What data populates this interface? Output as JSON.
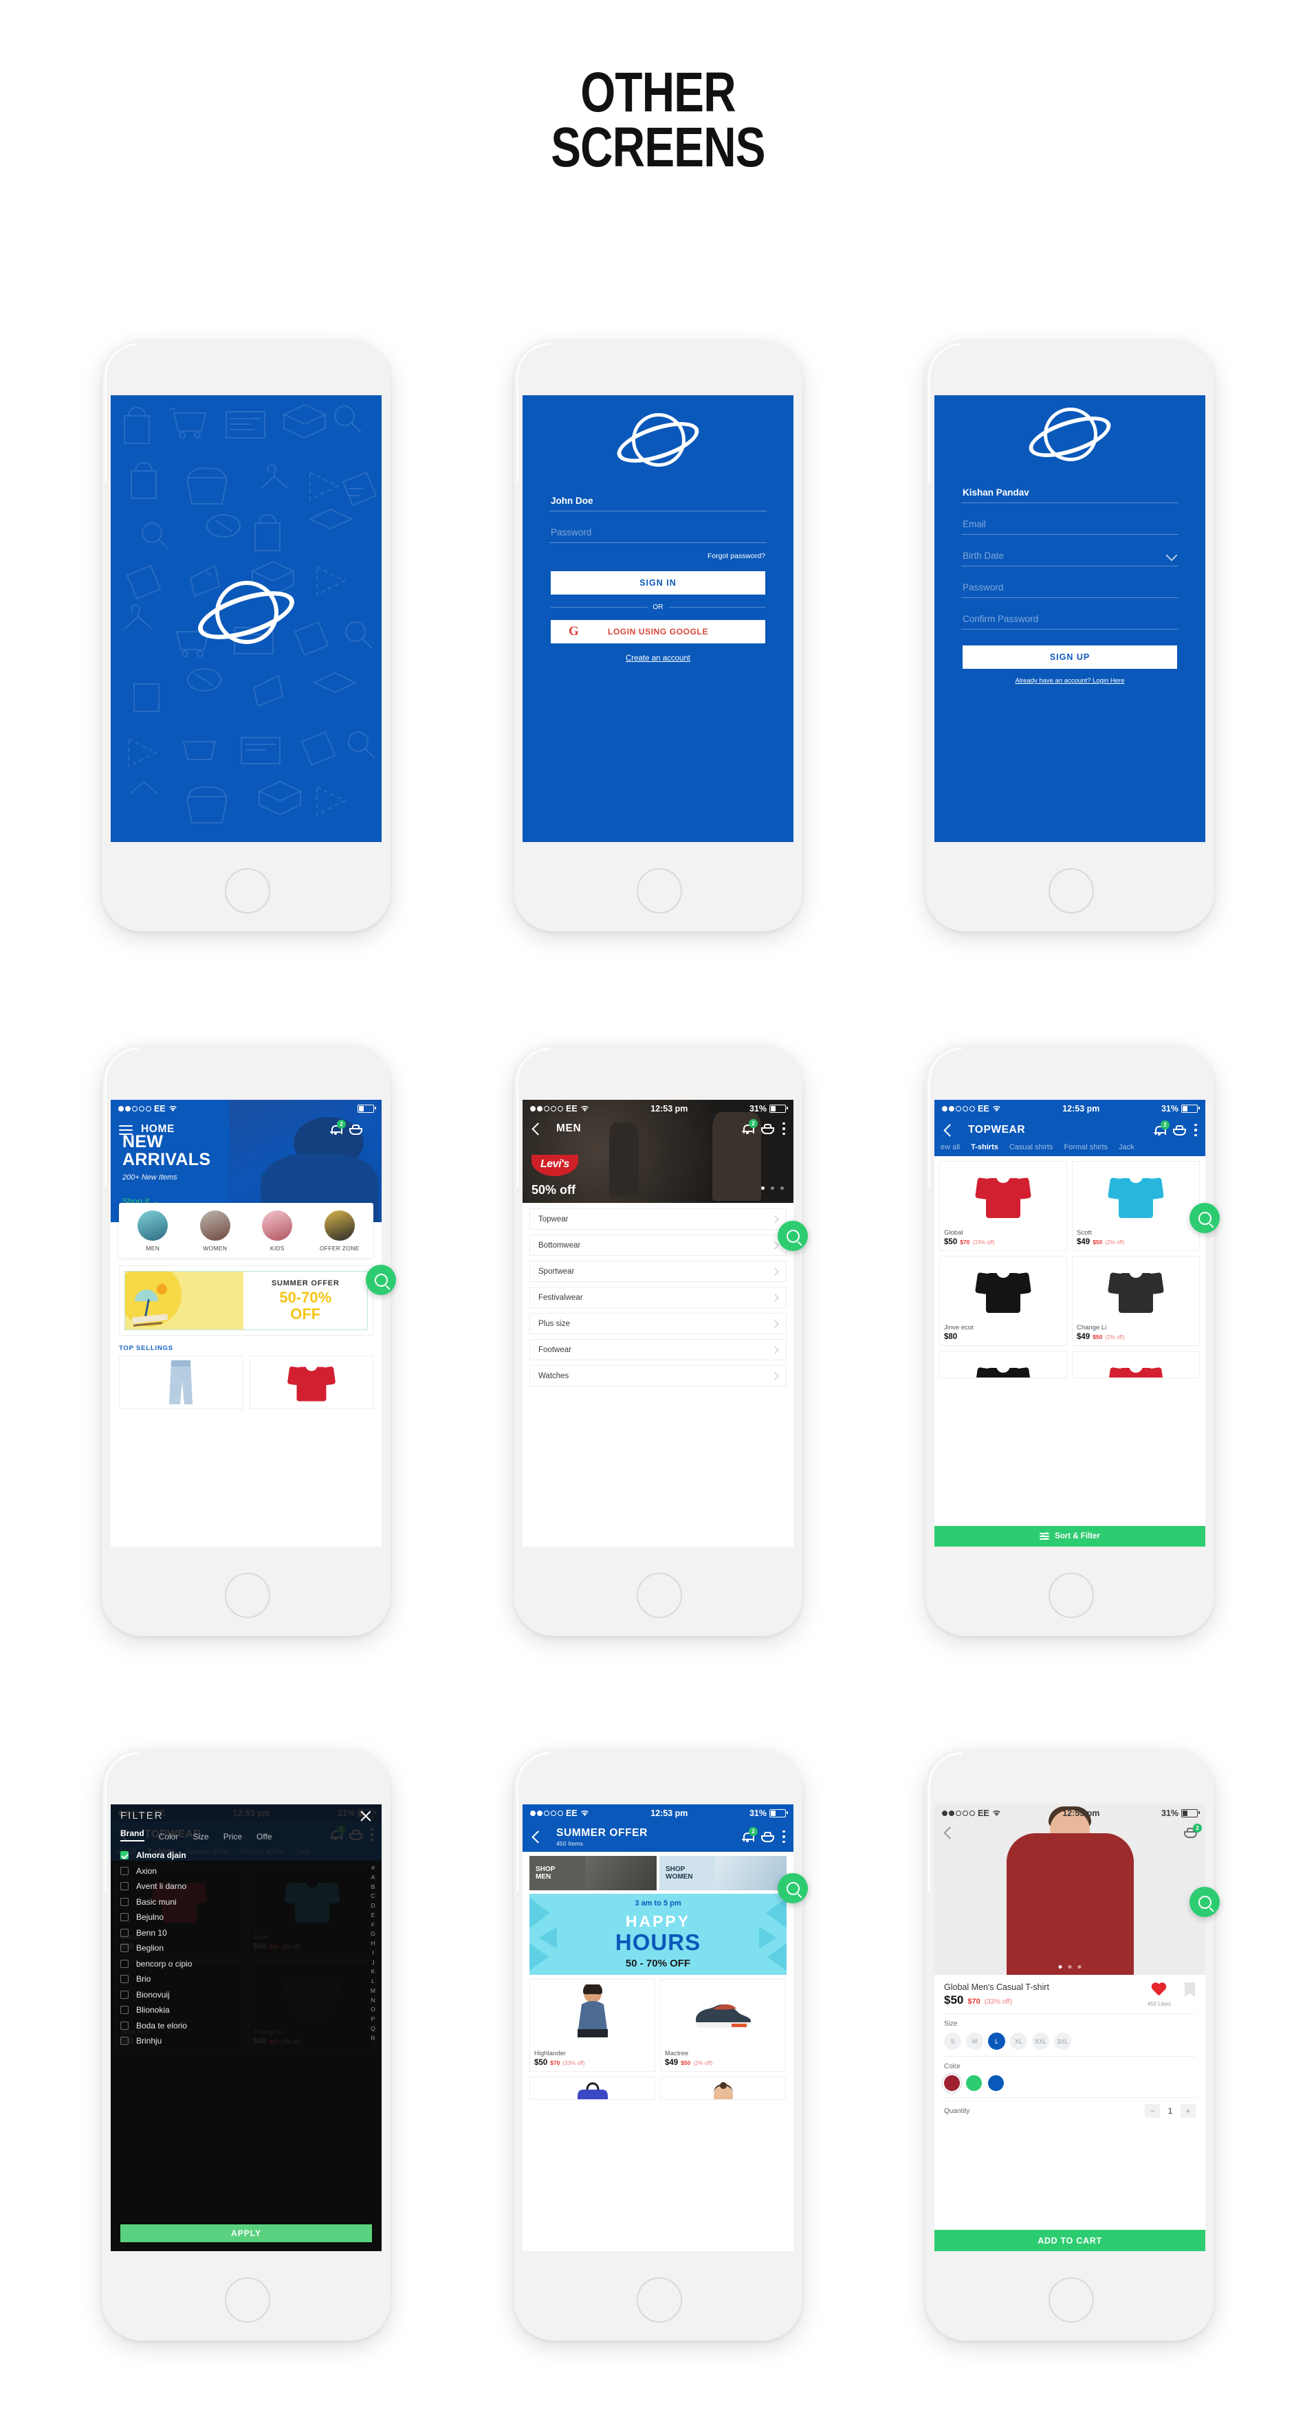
{
  "title": {
    "line1": "OTHER",
    "line2": "SCREENS"
  },
  "colors": {
    "brand_blue": "#0a58ba",
    "accent_green": "#2ecc71",
    "sale_red": "#e53935",
    "offer_yellow": "#f5c518",
    "dark": "#0c0c0c"
  },
  "status_bar": {
    "carrier": "EE",
    "time": "12:53 pm",
    "battery": "31%"
  },
  "screens": {
    "splash": {
      "name": "splash",
      "logo": "planet-logo"
    },
    "login": {
      "username_value": "John Doe",
      "password_placeholder": "Password",
      "forgot": "Forgot password?",
      "signin": "SIGN IN",
      "or": "OR",
      "google": "LOGIN USING GOOGLE",
      "google_mark": "G",
      "create": "Create an account"
    },
    "signup": {
      "name_value": "Kishan Pandav",
      "email_placeholder": "Email",
      "birth_placeholder": "Birth Date",
      "password_placeholder": "Password",
      "confirm_placeholder": "Confirm Password",
      "signup": "SIGN UP",
      "login_link": "Already have an account? Login Here"
    },
    "home": {
      "appbar_title": "HOME",
      "notif_count": "2",
      "hero_line1": "NEW",
      "hero_line2": "ARRIVALS",
      "hero_sub": "200+  New Items",
      "shop_it": "Shop it  →",
      "categories": [
        {
          "label": "MEN"
        },
        {
          "label": "WOMEN"
        },
        {
          "label": "KIDS"
        },
        {
          "label": "OFFER ZONE"
        }
      ],
      "offer_title": "SUMMER OFFER",
      "offer_line1": "50-70%",
      "offer_line2": "OFF",
      "top_sellings": "TOP SELLINGS"
    },
    "men": {
      "appbar_title": "MEN",
      "notif_count": "2",
      "banner_brand": "Levi's",
      "banner_off": "50% off",
      "items": [
        {
          "label": "Topwear"
        },
        {
          "label": "Bottomwear"
        },
        {
          "label": "Sportwear"
        },
        {
          "label": "Festivalwear"
        },
        {
          "label": "Plus size"
        },
        {
          "label": "Footwear"
        },
        {
          "label": "Watches"
        }
      ]
    },
    "topwear": {
      "appbar_title": "TOPWEAR",
      "notif_count": "2",
      "tabs": [
        {
          "label": "ew all",
          "active": false
        },
        {
          "label": "T-shirts",
          "active": true
        },
        {
          "label": "Casual shirts",
          "active": false
        },
        {
          "label": "Formal shirts",
          "active": false
        },
        {
          "label": "Jack",
          "active": false
        }
      ],
      "products": [
        {
          "name": "Global",
          "price": "$50",
          "old": "$70",
          "off": "(33% off)",
          "color": "#d22030"
        },
        {
          "name": "Scott",
          "price": "$49",
          "old": "$50",
          "off": "(2% off)",
          "color": "#29b6dd"
        },
        {
          "name": "Jinve ecot",
          "price": "$80",
          "old": "",
          "off": "",
          "color": "#141414"
        },
        {
          "name": "Change Li",
          "price": "$49",
          "old": "$50",
          "off": "(2% off)",
          "color": "#2d2d2d"
        }
      ],
      "sort_filter": "Sort & Filter"
    },
    "filter": {
      "title": "FILTER",
      "ghost_title": "TOPWEAR",
      "tabs": [
        {
          "label": "Brand",
          "active": true
        },
        {
          "label": "Color",
          "active": false
        },
        {
          "label": "Size",
          "active": false
        },
        {
          "label": "Price",
          "active": false
        },
        {
          "label": "Offe",
          "active": false
        }
      ],
      "brands": [
        {
          "name": "Almora djain",
          "checked": true
        },
        {
          "name": "Axion",
          "checked": false
        },
        {
          "name": "Avent li darno",
          "checked": false
        },
        {
          "name": "Basic muni",
          "checked": false
        },
        {
          "name": "Bejulno",
          "checked": false
        },
        {
          "name": "Benn 10",
          "checked": false
        },
        {
          "name": "Beglion",
          "checked": false
        },
        {
          "name": "bencorp o cipio",
          "checked": false
        },
        {
          "name": "Brio",
          "checked": false
        },
        {
          "name": "Bionovuij",
          "checked": false
        },
        {
          "name": "Blionokia",
          "checked": false
        },
        {
          "name": "Boda te elorio",
          "checked": false
        },
        {
          "name": "Brinhju",
          "checked": false
        }
      ],
      "alpha_index": [
        "#",
        "A",
        "B",
        "C",
        "D",
        "E",
        "F",
        "G",
        "H",
        "I",
        "J",
        "K",
        "L",
        "M",
        "N",
        "O",
        "P",
        "Q",
        "R"
      ],
      "apply": "APPLY"
    },
    "summer": {
      "appbar_title": "SUMMER OFFER",
      "appbar_sub": "450 Items",
      "notif_count": "2",
      "shop_men_l1": "SHOP",
      "shop_men_l2": "MEN",
      "shop_women_l1": "SHOP",
      "shop_women_l2": "WOMEN",
      "happy_time": "3 am to 5 pm",
      "happy_l1": "HAPPY",
      "happy_l2": "HOURS",
      "happy_off": "50 - 70% OFF",
      "products": [
        {
          "name": "Highlander",
          "price": "$50",
          "old": "$70",
          "off": "(33% off)"
        },
        {
          "name": "Mactree",
          "price": "$49",
          "old": "$50",
          "off": "(2% off)"
        }
      ]
    },
    "detail": {
      "notif_count": "2",
      "title": "Global Men's Casual T-shirt",
      "price": "$50",
      "old_price": "$70",
      "discount": "(33% off)",
      "likes": "450 Likes",
      "size_label": "Size",
      "sizes": [
        {
          "label": "S",
          "selected": false
        },
        {
          "label": "M",
          "selected": false
        },
        {
          "label": "L",
          "selected": true
        },
        {
          "label": "XL",
          "selected": false
        },
        {
          "label": "XXL",
          "selected": false
        },
        {
          "label": "3XL",
          "selected": false
        }
      ],
      "color_label": "Color",
      "colors": [
        {
          "hex": "#9e2230",
          "selected": true
        },
        {
          "hex": "#2ecc71",
          "selected": false
        },
        {
          "hex": "#0a58ba",
          "selected": false
        }
      ],
      "quantity_label": "Quantity",
      "quantity_value": "1",
      "minus": "−",
      "plus": "+",
      "add_to_cart": "ADD TO CART"
    }
  }
}
